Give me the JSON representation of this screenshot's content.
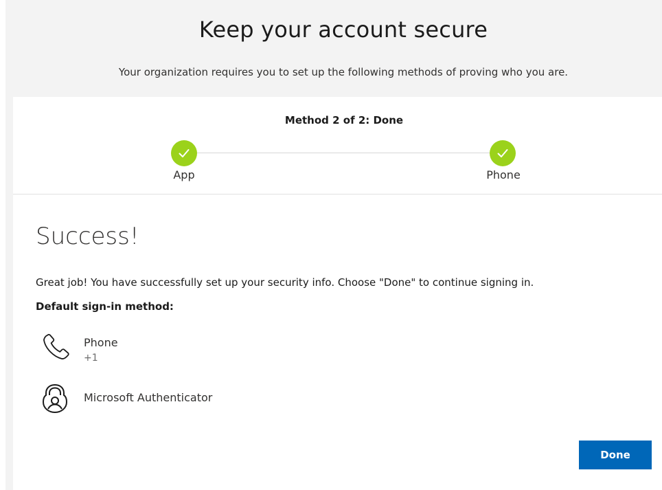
{
  "header": {
    "title": "Keep your account secure",
    "subtitle": "Your organization requires you to set up the following methods of proving who you are."
  },
  "progress": {
    "method_label": "Method 2 of 2: Done",
    "steps": [
      {
        "label": "App",
        "status": "complete"
      },
      {
        "label": "Phone",
        "status": "complete"
      }
    ]
  },
  "content": {
    "title": "Success!",
    "message": "Great job! You have successfully set up your security info. Choose \"Done\" to continue signing in.",
    "default_label": "Default sign-in method:",
    "methods": [
      {
        "name": "Phone",
        "detail": "+1",
        "icon": "phone-icon"
      },
      {
        "name": "Microsoft Authenticator",
        "icon": "authenticator-lock-icon"
      }
    ]
  },
  "actions": {
    "done_label": "Done"
  },
  "colors": {
    "step_complete": "#9bd21b",
    "primary_button": "#0067b8"
  }
}
